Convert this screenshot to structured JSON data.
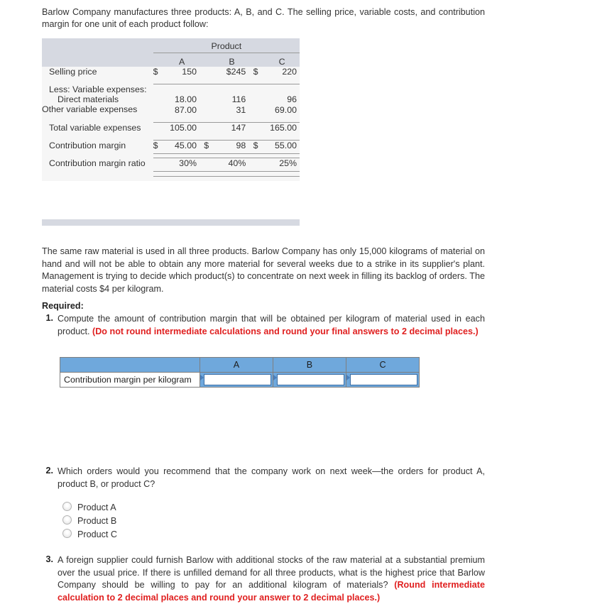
{
  "intro": {
    "text": "Barlow Company manufactures three products: A, B, and C. The selling price, variable costs, and contribution margin for one unit of each product follow:"
  },
  "product_table": {
    "group_header": "Product",
    "columns": [
      "A",
      "B",
      "C"
    ],
    "rows": [
      {
        "label": "Selling price",
        "cells": [
          {
            "symbol": "$",
            "value": "150"
          },
          {
            "symbol": "",
            "value": "$245"
          },
          {
            "symbol": "$",
            "value": "220"
          }
        ]
      },
      {
        "label": "Less: Variable expenses:",
        "cells": [
          {
            "symbol": "",
            "value": ""
          },
          {
            "symbol": "",
            "value": ""
          },
          {
            "symbol": "",
            "value": ""
          }
        ]
      },
      {
        "label": "Direct materials",
        "cells": [
          {
            "symbol": "",
            "value": "18.00"
          },
          {
            "symbol": "",
            "value": "116"
          },
          {
            "symbol": "",
            "value": "96"
          }
        ]
      },
      {
        "label": "Other variable expenses",
        "cells": [
          {
            "symbol": "",
            "value": "87.00"
          },
          {
            "symbol": "",
            "value": "31"
          },
          {
            "symbol": "",
            "value": "69.00"
          }
        ]
      },
      {
        "label": "Total variable expenses",
        "cells": [
          {
            "symbol": "",
            "value": "105.00"
          },
          {
            "symbol": "",
            "value": "147"
          },
          {
            "symbol": "",
            "value": "165.00"
          }
        ]
      },
      {
        "label": "Contribution margin",
        "cells": [
          {
            "symbol": "$",
            "value": "45.00"
          },
          {
            "symbol": "$",
            "value": "98"
          },
          {
            "symbol": "$",
            "value": "55.00"
          }
        ]
      },
      {
        "label": "Contribution margin ratio",
        "cells": [
          {
            "symbol": "",
            "value": "30%"
          },
          {
            "symbol": "",
            "value": "40%"
          },
          {
            "symbol": "",
            "value": "25%"
          }
        ]
      }
    ]
  },
  "paragraph": {
    "text": "The same raw material is used in all three products. Barlow Company has only 15,000 kilograms of material on hand and will not be able to obtain any more material for several weeks due to a strike in its supplier's plant. Management is trying to decide which product(s) to concentrate on next week in filling its backlog of orders. The material costs $4 per kilogram."
  },
  "required": {
    "label": "Required:"
  },
  "questions": [
    {
      "number": "1.",
      "text": "Compute the amount of contribution margin that will be obtained per kilogram of material used in each product. ",
      "instruction": "(Do not round intermediate calculations and round your final answers to 2 decimal places.)"
    },
    {
      "number": "2.",
      "text": "Which orders would you recommend that the company work on next week—the orders for product A, product B, or product C?",
      "instruction": ""
    },
    {
      "number": "3.",
      "text": "A foreign supplier could furnish Barlow with additional stocks of the raw material at a substantial premium over the usual price. If there is unfilled demand for all three products, what is the highest price that Barlow Company should be willing to pay for an additional kilogram of materials? ",
      "instruction": "(Round intermediate calculation to 2 decimal places and round your answer to 2 decimal places.)"
    }
  ],
  "answer_table": {
    "corner_label": "",
    "columns": [
      "A",
      "B",
      "C"
    ],
    "row_label": "Contribution margin per kilogram",
    "values": [
      "",
      "",
      ""
    ]
  },
  "radio_options": [
    {
      "label": "Product A",
      "selected": false
    },
    {
      "label": "Product B",
      "selected": false
    },
    {
      "label": "Product C",
      "selected": false
    }
  ],
  "colors": {
    "table_header_band": "#d6d9e1",
    "table_body": "#f6f6f6",
    "answer_header_blue": "#6fa8dc",
    "instruction_red": "#e02020"
  }
}
